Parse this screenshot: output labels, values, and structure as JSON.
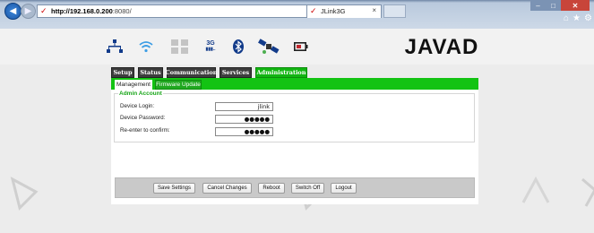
{
  "browser": {
    "url_host": "http://192.168.0.200",
    "url_rest": ":8080/",
    "address_controls": "⌕ ▾ ↻",
    "tab_title": "JLink3G",
    "tab_close": "×",
    "window_buttons": {
      "minimize": "–",
      "maximize": "□",
      "close": "✕"
    },
    "toolbar_icons": "⌂★⚙"
  },
  "device_icons": [
    "network-icon",
    "wifi-icon",
    "cellular-icon",
    "3g-signal-icon",
    "bluetooth-icon",
    "satellite-icon",
    "battery-icon"
  ],
  "signal_3g": {
    "label": "3G",
    "bars": "▮▮▮.."
  },
  "brand": {
    "logo_text": "JAVAD",
    "accent_color": "#13c313",
    "dark_tab_color": "#3d3d3d"
  },
  "menu": {
    "tabs": [
      "Setup",
      "Status",
      "Communication",
      "Services",
      "Administration"
    ],
    "active": "Administration"
  },
  "submenu": {
    "tabs": [
      "Management",
      "Firmware Update"
    ],
    "active": "Management"
  },
  "admin_account": {
    "legend": "Admin Account",
    "fields": [
      {
        "label": "Device Login:",
        "value": "jlink"
      },
      {
        "label": "Device Password:",
        "value": "●●●●●"
      },
      {
        "label": "Re-enter to confirm:",
        "value": "●●●●●"
      }
    ]
  },
  "buttons": [
    "Save Settings",
    "Cancel Changes",
    "Reboot",
    "Switch Off",
    "Logout"
  ]
}
